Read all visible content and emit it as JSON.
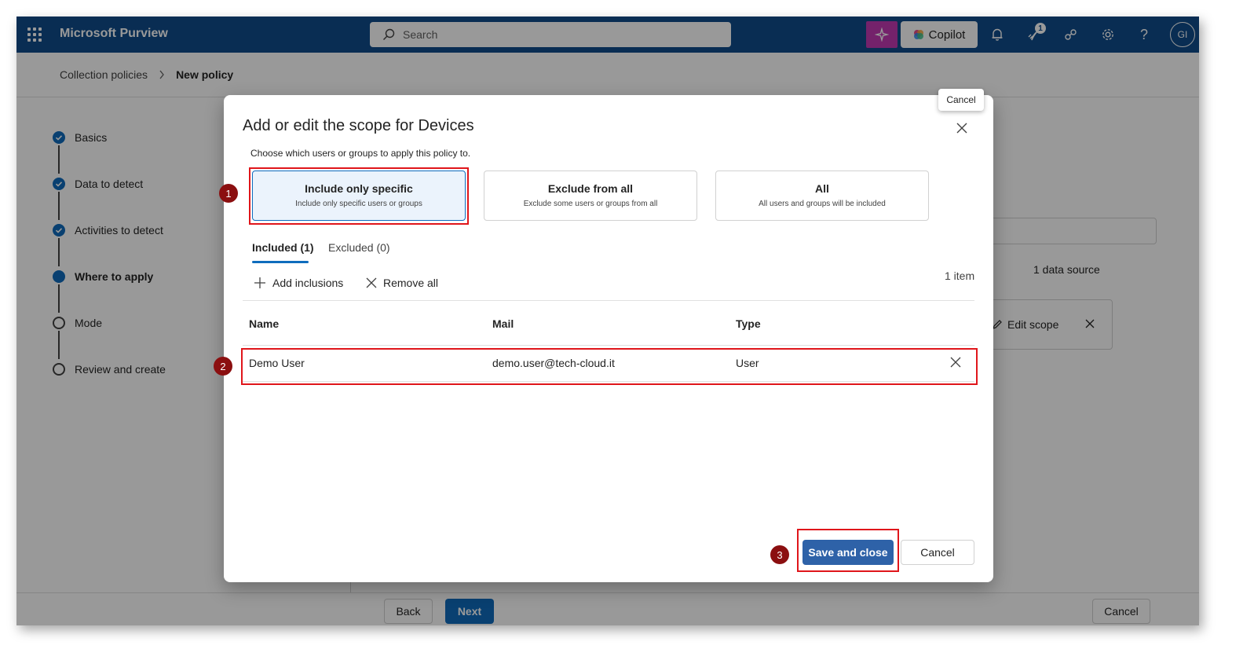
{
  "topbar": {
    "app_name": "Microsoft Purview",
    "search_placeholder": "Search",
    "copilot_label": "Copilot",
    "notification_count": "1",
    "avatar_initials": "GI",
    "brand_color": "#0f4c8a",
    "icons": [
      "waffle-icon",
      "search-icon",
      "sparkle-icon",
      "copilot-icon",
      "bell-icon",
      "rocket-icon",
      "connection-icon",
      "gear-icon",
      "help-icon"
    ]
  },
  "breadcrumb": {
    "items": [
      "Collection policies",
      "New policy"
    ]
  },
  "steps": [
    {
      "label": "Basics",
      "state": "done"
    },
    {
      "label": "Data to detect",
      "state": "done"
    },
    {
      "label": "Activities to detect",
      "state": "done"
    },
    {
      "label": "Where to apply",
      "state": "current"
    },
    {
      "label": "Mode",
      "state": "todo"
    },
    {
      "label": "Review and create",
      "state": "todo"
    }
  ],
  "background": {
    "data_source_count": "1 data source",
    "edit_scope_label": "Edit scope"
  },
  "footer": {
    "back_label": "Back",
    "next_label": "Next",
    "cancel_label": "Cancel"
  },
  "dialog": {
    "title": "Add or edit the scope for Devices",
    "close_tooltip": "Cancel",
    "subtitle": "Choose which users or groups to apply this policy to.",
    "options": [
      {
        "title": "Include only specific",
        "desc": "Include only specific users or groups",
        "selected": true
      },
      {
        "title": "Exclude from all",
        "desc": "Exclude some users or groups from all",
        "selected": false
      },
      {
        "title": "All",
        "desc": "All users and groups will be included",
        "selected": false
      }
    ],
    "tabs": [
      "Included (1)",
      "Excluded (0)"
    ],
    "commands": {
      "add": "Add inclusions",
      "remove": "Remove all"
    },
    "item_count": "1 item",
    "columns": [
      "Name",
      "Mail",
      "Type"
    ],
    "rows": [
      {
        "name": "Demo User",
        "mail": "demo.user@tech-cloud.it",
        "type": "User"
      }
    ],
    "save_label": "Save and close",
    "cancel_label": "Cancel"
  },
  "annotations": {
    "markers": [
      "1",
      "2",
      "3"
    ],
    "highlight_color": "#e0161b"
  }
}
